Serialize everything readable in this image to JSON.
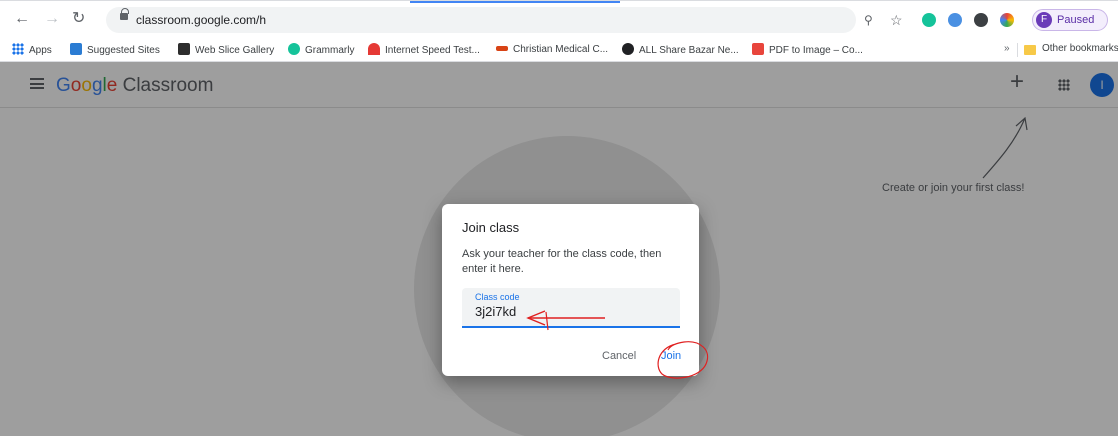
{
  "browser": {
    "url": "classroom.google.com/h",
    "profile_initial": "F",
    "profile_status": "Paused",
    "bookmarks": [
      {
        "label": "Apps",
        "color": "#1a73e8"
      },
      {
        "label": "Suggested Sites",
        "color": "#2b7cd3"
      },
      {
        "label": "Web Slice Gallery",
        "color": "#2d2d2d"
      },
      {
        "label": "Grammarly",
        "color": "#15c39a"
      },
      {
        "label": "Internet Speed Test...",
        "color": "#e53935"
      },
      {
        "label": "Christian Medical C...",
        "color": "#d84315"
      },
      {
        "label": "ALL Share Bazar Ne...",
        "color": "#202124"
      },
      {
        "label": "PDF to Image – Co...",
        "color": "#e8453c"
      }
    ],
    "more_bookmarks": "»",
    "other_bookmarks": "Other bookmarks"
  },
  "app": {
    "brand": "Google",
    "product": "Classroom",
    "avatar_initial": "I",
    "empty_hint": "Create or join your first class!"
  },
  "dialog": {
    "title": "Join class",
    "body": "Ask your teacher for the class code, then enter it here.",
    "field_label": "Class code",
    "field_value": "3j2i7kd",
    "cancel_label": "Cancel",
    "join_label": "Join"
  },
  "colors": {
    "accent": "#1a73e8",
    "annotation": "#e02020"
  }
}
